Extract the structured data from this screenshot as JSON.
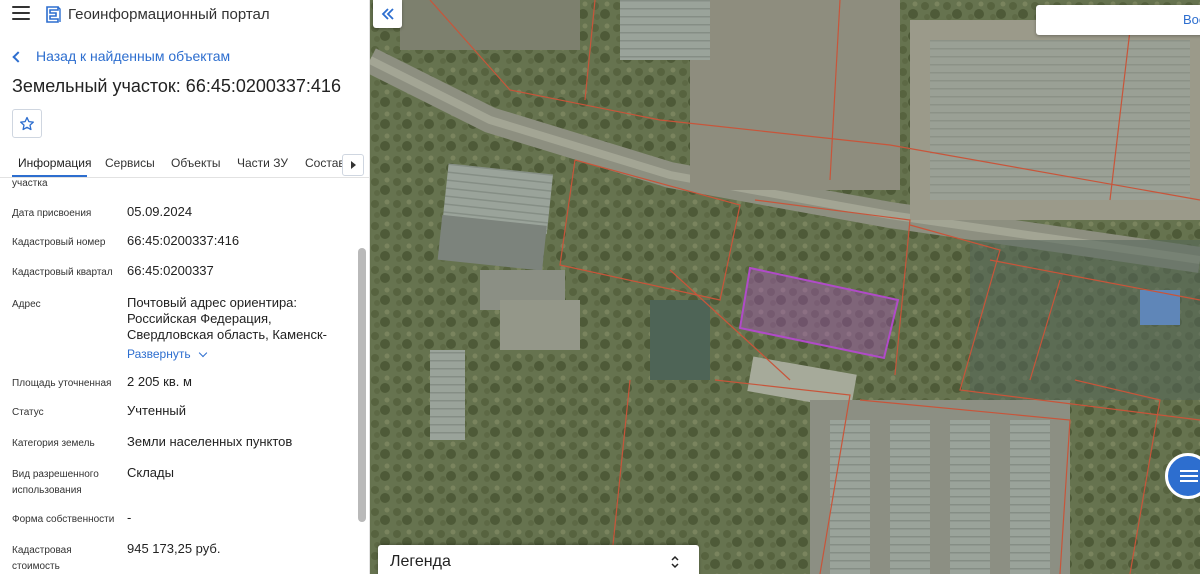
{
  "app": {
    "title": "Геоинформационный портал"
  },
  "nav": {
    "back_label": "Назад к найденным объектам"
  },
  "page": {
    "title": "Земельный участок: 66:45:0200337:416"
  },
  "tabs": [
    {
      "label": "Информация",
      "active": true
    },
    {
      "label": "Сервисы"
    },
    {
      "label": "Объекты"
    },
    {
      "label": "Части ЗУ"
    },
    {
      "label": "Состав"
    }
  ],
  "properties": [
    {
      "label": "участка",
      "value": ""
    },
    {
      "label": "Дата присвоения",
      "value": "05.09.2024"
    },
    {
      "label": "Кадастровый номер",
      "value": "66:45:0200337:416"
    },
    {
      "label": "Кадастровый квартал",
      "value": "66:45:0200337"
    },
    {
      "label": "Адрес",
      "value": "Почтовый адрес ориентира: Российская Федерация, Свердловская область, Каменск-"
    },
    {
      "label": "Площадь уточненная",
      "value": "2 205 кв. м"
    },
    {
      "label": "Статус",
      "value": "Учтенный"
    },
    {
      "label": "Категория земель",
      "value": "Земли населенных пунктов"
    },
    {
      "label": "Вид разрешенного использования",
      "value": "Склады"
    },
    {
      "label": "Форма собственности",
      "value": "-"
    },
    {
      "label": "Кадастровая стоимость",
      "value": "945 173,25 руб."
    }
  ],
  "address_expand_label": "Развернуть",
  "map": {
    "search_text": "Вос",
    "legend_label": "Легенда",
    "highlight_color": "#b04bc8",
    "boundary_color": "#c8553a"
  },
  "colors": {
    "accent": "#2d6ecf"
  }
}
